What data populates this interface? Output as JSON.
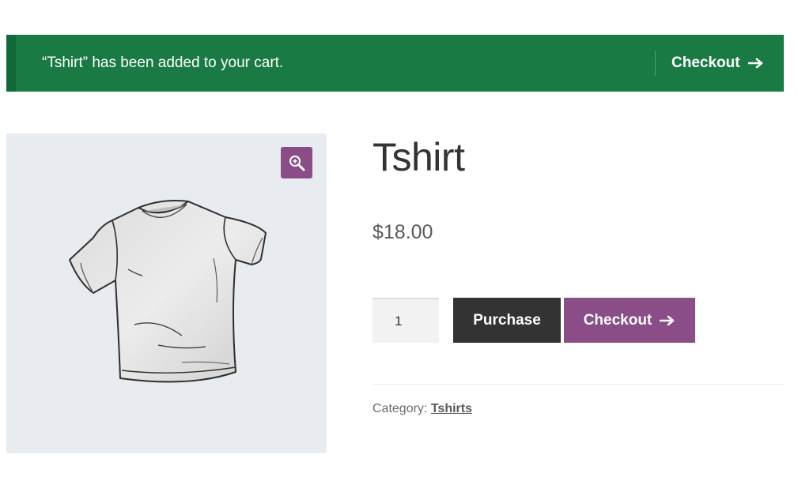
{
  "notice": {
    "message": "“Tshirt” has been added to your cart.",
    "checkout_label": "Checkout",
    "background_color": "#1a7a44"
  },
  "gallery": {
    "zoom_icon": "magnifier-plus-icon",
    "image_icon": "tshirt-image",
    "accent_color": "#8a4d87"
  },
  "product": {
    "title": "Tshirt",
    "price": "$18.00",
    "quantity": "1",
    "purchase_label": "Purchase",
    "checkout_label": "Checkout",
    "category_label": "Category:",
    "category_value": "Tshirts"
  }
}
